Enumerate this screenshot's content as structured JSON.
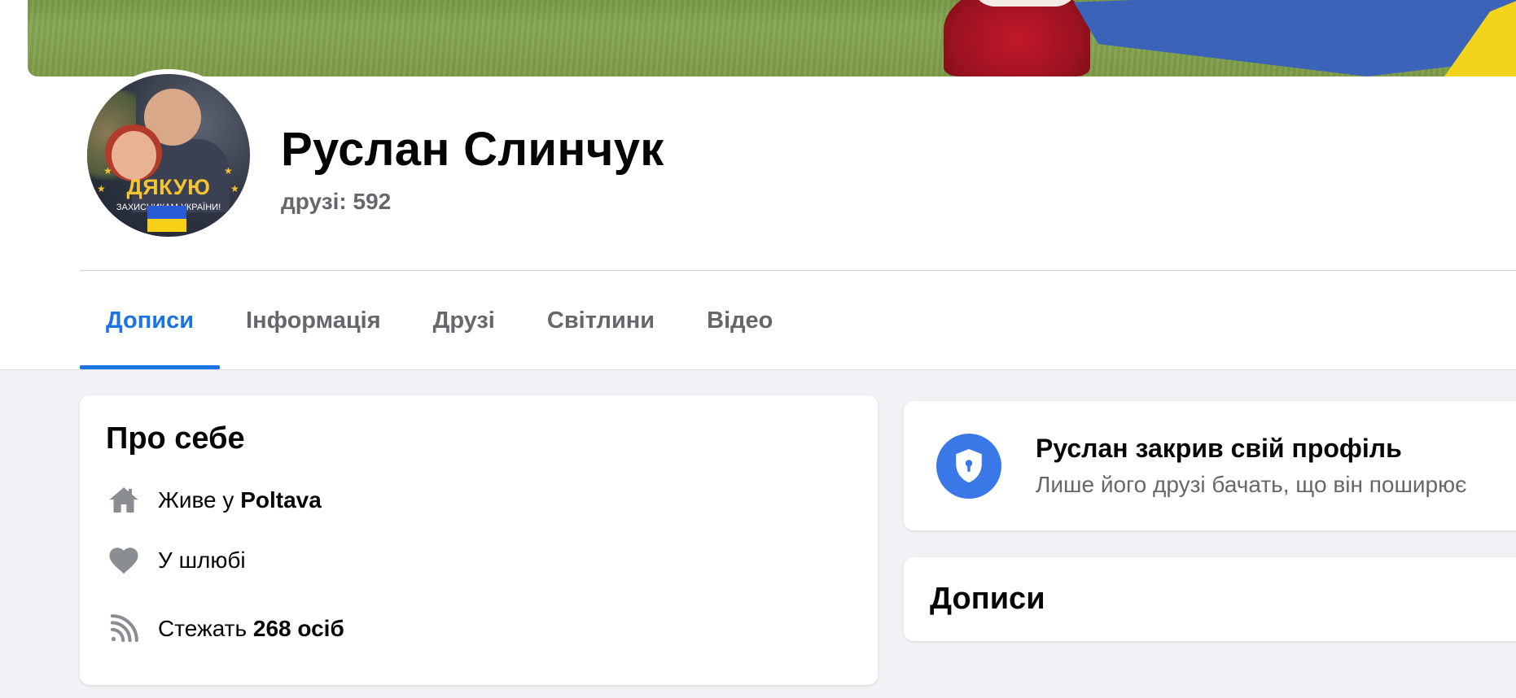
{
  "profile": {
    "name": "Руслан Слинчук",
    "friends": "друзі: 592",
    "avatar_text_main": "ДЯКУЮ",
    "avatar_text_sub": "ЗАХИСНИКАМ УКРАЇНИ!"
  },
  "tabs": [
    {
      "label": "Дописи",
      "active": true
    },
    {
      "label": "Інформація",
      "active": false
    },
    {
      "label": "Друзі",
      "active": false
    },
    {
      "label": "Світлини",
      "active": false
    },
    {
      "label": "Відео",
      "active": false
    }
  ],
  "about": {
    "title": "Про себе",
    "lives_prefix": "Живе у",
    "lives_city": "Poltava",
    "relationship": "У шлюбі",
    "followers_prefix": "Стежать",
    "followers_value": "268 осіб"
  },
  "locked": {
    "title": "Руслан закрив свій профіль",
    "subtitle": "Лише його друзі бачать, що він поширює"
  },
  "posts": {
    "title": "Дописи"
  },
  "icons": {
    "home": "home-icon",
    "heart": "heart-icon",
    "rss": "followers-icon",
    "shield": "shield-lock-icon"
  },
  "colors": {
    "accent": "#1b74e4",
    "shield_bg": "#3b78e7",
    "muted_text": "#65676b",
    "background": "#f0f2f5"
  }
}
